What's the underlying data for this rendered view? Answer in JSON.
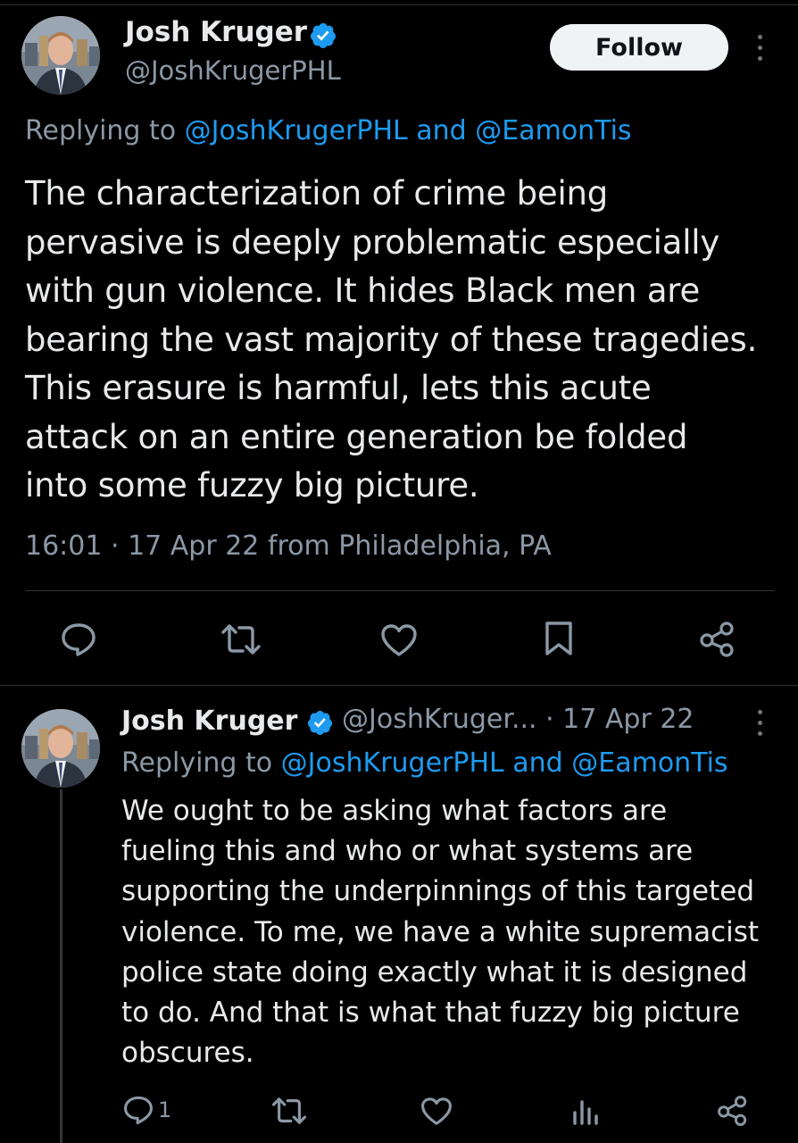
{
  "main_tweet": {
    "author": {
      "display_name": "Josh Kruger",
      "handle": "@JoshKrugerPHL",
      "verified": true
    },
    "follow_label": "Follow",
    "replying_prefix": "Replying to ",
    "replying_to": [
      "@JoshKrugerPHL",
      "@EamonTis"
    ],
    "replying_joiner": " and ",
    "text_lines": [
      "The characterization of crime being",
      "pervasive is deeply problematic especially",
      "with gun violence. It hides Black men are",
      "bearing the vast majority of these tragedies.",
      "This erasure is harmful, lets this acute",
      "attack on an entire generation be folded",
      "into some fuzzy big picture."
    ],
    "timestamp": "16:01 · 17 Apr 22 from Philadelphia, PA",
    "actions": [
      "reply-icon",
      "retweet-icon",
      "like-icon",
      "bookmark-icon",
      "share-icon"
    ]
  },
  "reply_tweet": {
    "author": {
      "display_name": "Josh Kruger",
      "handle_truncated": "@JoshKruger...",
      "verified": true
    },
    "meta_separator": " · ",
    "date": "17 Apr 22",
    "replying_prefix": "Replying to ",
    "replying_to": [
      "@JoshKrugerPHL",
      "@EamonTis"
    ],
    "replying_joiner": " and ",
    "text_lines": [
      "We ought to be asking what factors are",
      "fueling this and who or what systems are",
      "supporting the underpinnings of this targeted",
      "violence. To me, we have a white supremacist",
      "police state doing exactly what it is designed",
      "to do. And that is what that fuzzy big picture",
      "obscures."
    ],
    "actions": {
      "reply_count": "1",
      "icons": [
        "reply-icon",
        "retweet-icon",
        "like-icon",
        "views-icon",
        "share-icon"
      ]
    }
  },
  "colors": {
    "background": "#000000",
    "text_primary": "#e7e9ea",
    "text_secondary": "#8b98a5",
    "link": "#1d9bf0",
    "verified_badge": "#1d9bf0",
    "follow_button_bg": "#eff3f4",
    "divider": "#2f3336"
  }
}
